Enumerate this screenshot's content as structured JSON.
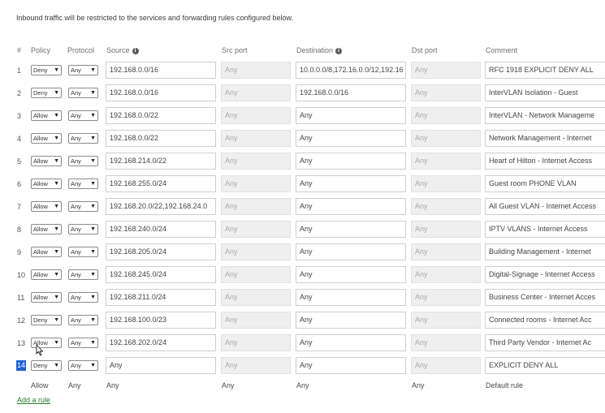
{
  "intro": "Inbound traffic will be restricted to the services and forwarding rules configured below.",
  "headers": {
    "num": "#",
    "policy": "Policy",
    "protocol": "Protocol",
    "source": "Source",
    "src_port": "Src port",
    "destination": "Destination",
    "dst_port": "Dst port",
    "comment": "Comment"
  },
  "rules": [
    {
      "num": "1",
      "policy": "Deny",
      "protocol": "Any",
      "source": "192.168.0.0/16",
      "src_port": "Any",
      "destination": "10.0.0.0/8,172.16.0.0/12,192.16",
      "dst_port": "Any",
      "comment": "RFC 1918 EXPLICIT DENY ALL"
    },
    {
      "num": "2",
      "policy": "Deny",
      "protocol": "Any",
      "source": "192.168.0.0/16",
      "src_port": "Any",
      "destination": "192.168.0.0/16",
      "dst_port": "Any",
      "comment": "InterVLAN Isolation - Guest"
    },
    {
      "num": "3",
      "policy": "Allow",
      "protocol": "Any",
      "source": "192.168.0.0/22",
      "src_port": "Any",
      "destination": "Any",
      "dst_port": "Any",
      "comment": "InterVLAN - Network Manageme"
    },
    {
      "num": "4",
      "policy": "Allow",
      "protocol": "Any",
      "source": "192.168.0.0/22",
      "src_port": "Any",
      "destination": "Any",
      "dst_port": "Any",
      "comment": "Network Management  - Internet"
    },
    {
      "num": "5",
      "policy": "Allow",
      "protocol": "Any",
      "source": "192.168.214.0/22",
      "src_port": "Any",
      "destination": "Any",
      "dst_port": "Any",
      "comment": "Heart of Hilton - Internet Access"
    },
    {
      "num": "6",
      "policy": "Allow",
      "protocol": "Any",
      "source": "192.168.255.0/24",
      "src_port": "Any",
      "destination": "Any",
      "dst_port": "Any",
      "comment": "Guest room PHONE VLAN"
    },
    {
      "num": "7",
      "policy": "Allow",
      "protocol": "Any",
      "source": "192.168.20.0/22,192.168.24.0",
      "src_port": "Any",
      "destination": "Any",
      "dst_port": "Any",
      "comment": "All Guest VLAN - Internet Access"
    },
    {
      "num": "8",
      "policy": "Allow",
      "protocol": "Any",
      "source": "192.168.240.0/24",
      "src_port": "Any",
      "destination": "Any",
      "dst_port": "Any",
      "comment": "IPTV VLANS - Internet Access"
    },
    {
      "num": "9",
      "policy": "Allow",
      "protocol": "Any",
      "source": "192.168.205.0/24",
      "src_port": "Any",
      "destination": "Any",
      "dst_port": "Any",
      "comment": "Building Management - Internet"
    },
    {
      "num": "10",
      "policy": "Allow",
      "protocol": "Any",
      "source": "192.168.245.0/24",
      "src_port": "Any",
      "destination": "Any",
      "dst_port": "Any",
      "comment": "Digital-Signage - Internet Access"
    },
    {
      "num": "11",
      "policy": "Allow",
      "protocol": "Any",
      "source": "192.168.211.0/24",
      "src_port": "Any",
      "destination": "Any",
      "dst_port": "Any",
      "comment": "Business Center - Internet Acces"
    },
    {
      "num": "12",
      "policy": "Deny",
      "protocol": "Any",
      "source": "192.168.100.0/23",
      "src_port": "Any",
      "destination": "Any",
      "dst_port": "Any",
      "comment": "Connected rooms  - Internet Acc"
    },
    {
      "num": "13",
      "policy": "Allow",
      "protocol": "Any",
      "source": "192.168.202.0/24",
      "src_port": "Any",
      "destination": "Any",
      "dst_port": "Any",
      "comment": "Third Party Vendor - Internet Ac"
    },
    {
      "num": "14",
      "policy": "Deny",
      "protocol": "Any",
      "source": "Any",
      "src_port": "Any",
      "destination": "Any",
      "dst_port": "Any",
      "comment": "EXPLICIT DENY ALL"
    }
  ],
  "default_rule": {
    "policy": "Allow",
    "protocol": "Any",
    "source": "Any",
    "src_port": "Any",
    "destination": "Any",
    "dst_port": "Any",
    "comment": "Default rule"
  },
  "add_rule_label": "Add a rule",
  "selected_row_number": "14",
  "icons": {
    "info": "info-icon",
    "dropdown": "chevron-down-icon",
    "cursor": "mouse-cursor-icon"
  },
  "colors": {
    "selection": "#1e64d2",
    "link": "#2a7a2a",
    "disabled_field": "#efefef"
  }
}
